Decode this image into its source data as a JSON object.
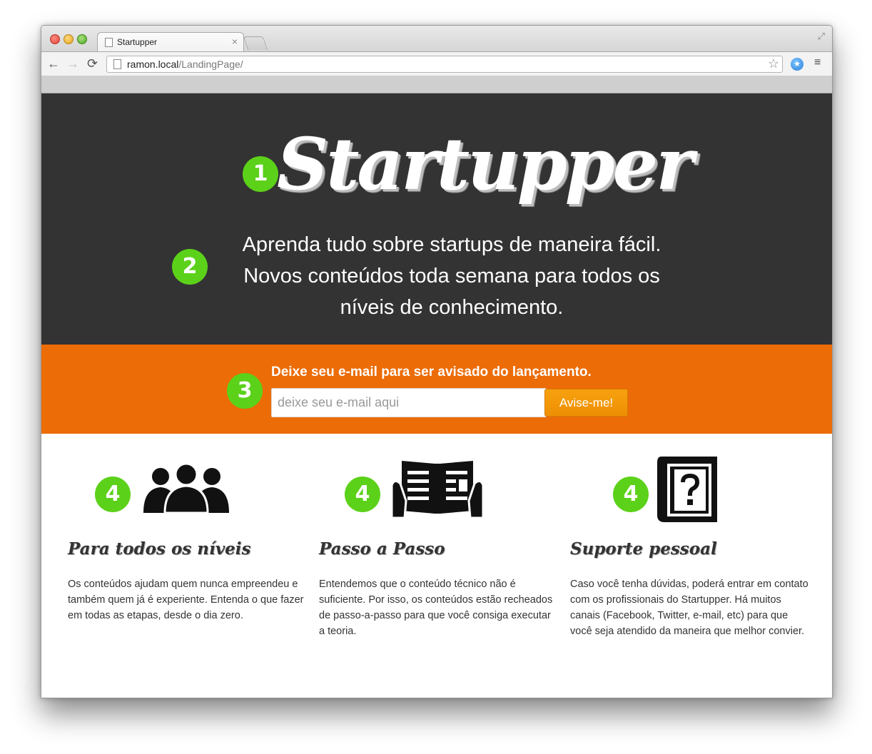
{
  "browser": {
    "tab_title": "Startupper",
    "tab_close": "×",
    "url_host": "ramon.local",
    "url_path": "/LandingPage/",
    "back_icon": "←",
    "forward_icon": "→",
    "reload_icon": "⟳",
    "star_icon": "☆",
    "menu_icon": "≡",
    "expand_icon": "⤢"
  },
  "hero": {
    "logo": "Startupper",
    "tagline_lines": [
      "Aprenda tudo sobre startups de maneira fácil.",
      "Novos conteúdos toda semana para todos os",
      "níveis de conhecimento."
    ],
    "badge_logo": "1",
    "badge_tagline": "2"
  },
  "signup": {
    "badge": "3",
    "label": "Deixe seu e-mail para ser avisado do lançamento.",
    "input_placeholder": "deixe seu e-mail aqui",
    "input_value": "",
    "button_label": "Avise-me!"
  },
  "features": [
    {
      "badge": "4",
      "icon": "people-icon",
      "title": "Para todos os níveis",
      "text": "Os conteúdos ajudam quem nunca empreendeu e também quem já é experiente. Entenda o que fazer em todas as etapas, desde o dia zero."
    },
    {
      "badge": "4",
      "icon": "newspaper-icon",
      "title": "Passo a Passo",
      "text": "Entendemos que o conteúdo técnico não é suficiente. Por isso, os conteúdos estão recheados de passo-a-passo para que você consiga executar a teoria."
    },
    {
      "badge": "4",
      "icon": "help-book-icon",
      "title": "Suporte pessoal",
      "text": "Caso você tenha dúvidas, poderá entrar em contato com os profissionais do Startupper. Há muitos canais (Facebook, Twitter, e-mail, etc) para que você seja atendido da maneira que melhor convier."
    }
  ],
  "colors": {
    "hero_bg": "#333333",
    "signup_bg": "#ec6c07",
    "badge": "#5cd11a",
    "button": "#f29a0b"
  }
}
